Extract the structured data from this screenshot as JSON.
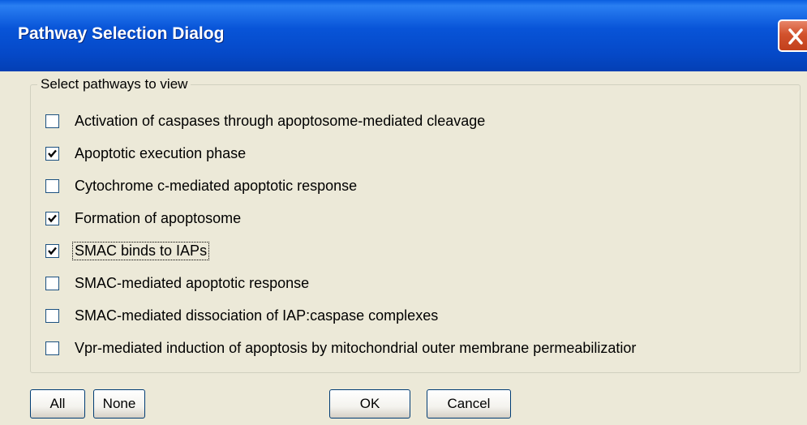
{
  "window": {
    "title": "Pathway Selection Dialog"
  },
  "group": {
    "legend": "Select pathways to view"
  },
  "pathways": [
    {
      "label": "Activation of caspases through apoptosome-mediated cleavage",
      "checked": false
    },
    {
      "label": "Apoptotic execution  phase",
      "checked": true
    },
    {
      "label": "Cytochrome c-mediated apoptotic response",
      "checked": false
    },
    {
      "label": "Formation of apoptosome",
      "checked": true
    },
    {
      "label": "SMAC binds to IAPs",
      "checked": true,
      "focused": true
    },
    {
      "label": "SMAC-mediated apoptotic response",
      "checked": false
    },
    {
      "label": "SMAC-mediated dissociation of IAP:caspase complexes",
      "checked": false
    },
    {
      "label": "Vpr-mediated induction of apoptosis by mitochondrial outer membrane permeabilizatior",
      "checked": false
    }
  ],
  "buttons": {
    "all": "All",
    "none": "None",
    "ok": "OK",
    "cancel": "Cancel"
  },
  "icons": {
    "close": "close-icon",
    "check": "checkmark-icon"
  },
  "colors": {
    "titlebar": "#0854d8",
    "close": "#d2522d",
    "background": "#ece9d8",
    "checkbox_border": "#1c5180"
  }
}
